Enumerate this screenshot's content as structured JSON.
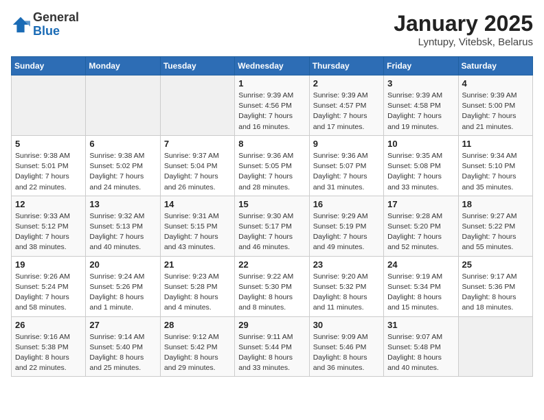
{
  "header": {
    "logo_general": "General",
    "logo_blue": "Blue",
    "month": "January 2025",
    "location": "Lyntupy, Vitebsk, Belarus"
  },
  "weekdays": [
    "Sunday",
    "Monday",
    "Tuesday",
    "Wednesday",
    "Thursday",
    "Friday",
    "Saturday"
  ],
  "weeks": [
    [
      {
        "day": "",
        "info": ""
      },
      {
        "day": "",
        "info": ""
      },
      {
        "day": "",
        "info": ""
      },
      {
        "day": "1",
        "info": "Sunrise: 9:39 AM\nSunset: 4:56 PM\nDaylight: 7 hours\nand 16 minutes."
      },
      {
        "day": "2",
        "info": "Sunrise: 9:39 AM\nSunset: 4:57 PM\nDaylight: 7 hours\nand 17 minutes."
      },
      {
        "day": "3",
        "info": "Sunrise: 9:39 AM\nSunset: 4:58 PM\nDaylight: 7 hours\nand 19 minutes."
      },
      {
        "day": "4",
        "info": "Sunrise: 9:39 AM\nSunset: 5:00 PM\nDaylight: 7 hours\nand 21 minutes."
      }
    ],
    [
      {
        "day": "5",
        "info": "Sunrise: 9:38 AM\nSunset: 5:01 PM\nDaylight: 7 hours\nand 22 minutes."
      },
      {
        "day": "6",
        "info": "Sunrise: 9:38 AM\nSunset: 5:02 PM\nDaylight: 7 hours\nand 24 minutes."
      },
      {
        "day": "7",
        "info": "Sunrise: 9:37 AM\nSunset: 5:04 PM\nDaylight: 7 hours\nand 26 minutes."
      },
      {
        "day": "8",
        "info": "Sunrise: 9:36 AM\nSunset: 5:05 PM\nDaylight: 7 hours\nand 28 minutes."
      },
      {
        "day": "9",
        "info": "Sunrise: 9:36 AM\nSunset: 5:07 PM\nDaylight: 7 hours\nand 31 minutes."
      },
      {
        "day": "10",
        "info": "Sunrise: 9:35 AM\nSunset: 5:08 PM\nDaylight: 7 hours\nand 33 minutes."
      },
      {
        "day": "11",
        "info": "Sunrise: 9:34 AM\nSunset: 5:10 PM\nDaylight: 7 hours\nand 35 minutes."
      }
    ],
    [
      {
        "day": "12",
        "info": "Sunrise: 9:33 AM\nSunset: 5:12 PM\nDaylight: 7 hours\nand 38 minutes."
      },
      {
        "day": "13",
        "info": "Sunrise: 9:32 AM\nSunset: 5:13 PM\nDaylight: 7 hours\nand 40 minutes."
      },
      {
        "day": "14",
        "info": "Sunrise: 9:31 AM\nSunset: 5:15 PM\nDaylight: 7 hours\nand 43 minutes."
      },
      {
        "day": "15",
        "info": "Sunrise: 9:30 AM\nSunset: 5:17 PM\nDaylight: 7 hours\nand 46 minutes."
      },
      {
        "day": "16",
        "info": "Sunrise: 9:29 AM\nSunset: 5:19 PM\nDaylight: 7 hours\nand 49 minutes."
      },
      {
        "day": "17",
        "info": "Sunrise: 9:28 AM\nSunset: 5:20 PM\nDaylight: 7 hours\nand 52 minutes."
      },
      {
        "day": "18",
        "info": "Sunrise: 9:27 AM\nSunset: 5:22 PM\nDaylight: 7 hours\nand 55 minutes."
      }
    ],
    [
      {
        "day": "19",
        "info": "Sunrise: 9:26 AM\nSunset: 5:24 PM\nDaylight: 7 hours\nand 58 minutes."
      },
      {
        "day": "20",
        "info": "Sunrise: 9:24 AM\nSunset: 5:26 PM\nDaylight: 8 hours\nand 1 minute."
      },
      {
        "day": "21",
        "info": "Sunrise: 9:23 AM\nSunset: 5:28 PM\nDaylight: 8 hours\nand 4 minutes."
      },
      {
        "day": "22",
        "info": "Sunrise: 9:22 AM\nSunset: 5:30 PM\nDaylight: 8 hours\nand 8 minutes."
      },
      {
        "day": "23",
        "info": "Sunrise: 9:20 AM\nSunset: 5:32 PM\nDaylight: 8 hours\nand 11 minutes."
      },
      {
        "day": "24",
        "info": "Sunrise: 9:19 AM\nSunset: 5:34 PM\nDaylight: 8 hours\nand 15 minutes."
      },
      {
        "day": "25",
        "info": "Sunrise: 9:17 AM\nSunset: 5:36 PM\nDaylight: 8 hours\nand 18 minutes."
      }
    ],
    [
      {
        "day": "26",
        "info": "Sunrise: 9:16 AM\nSunset: 5:38 PM\nDaylight: 8 hours\nand 22 minutes."
      },
      {
        "day": "27",
        "info": "Sunrise: 9:14 AM\nSunset: 5:40 PM\nDaylight: 8 hours\nand 25 minutes."
      },
      {
        "day": "28",
        "info": "Sunrise: 9:12 AM\nSunset: 5:42 PM\nDaylight: 8 hours\nand 29 minutes."
      },
      {
        "day": "29",
        "info": "Sunrise: 9:11 AM\nSunset: 5:44 PM\nDaylight: 8 hours\nand 33 minutes."
      },
      {
        "day": "30",
        "info": "Sunrise: 9:09 AM\nSunset: 5:46 PM\nDaylight: 8 hours\nand 36 minutes."
      },
      {
        "day": "31",
        "info": "Sunrise: 9:07 AM\nSunset: 5:48 PM\nDaylight: 8 hours\nand 40 minutes."
      },
      {
        "day": "",
        "info": ""
      }
    ]
  ]
}
